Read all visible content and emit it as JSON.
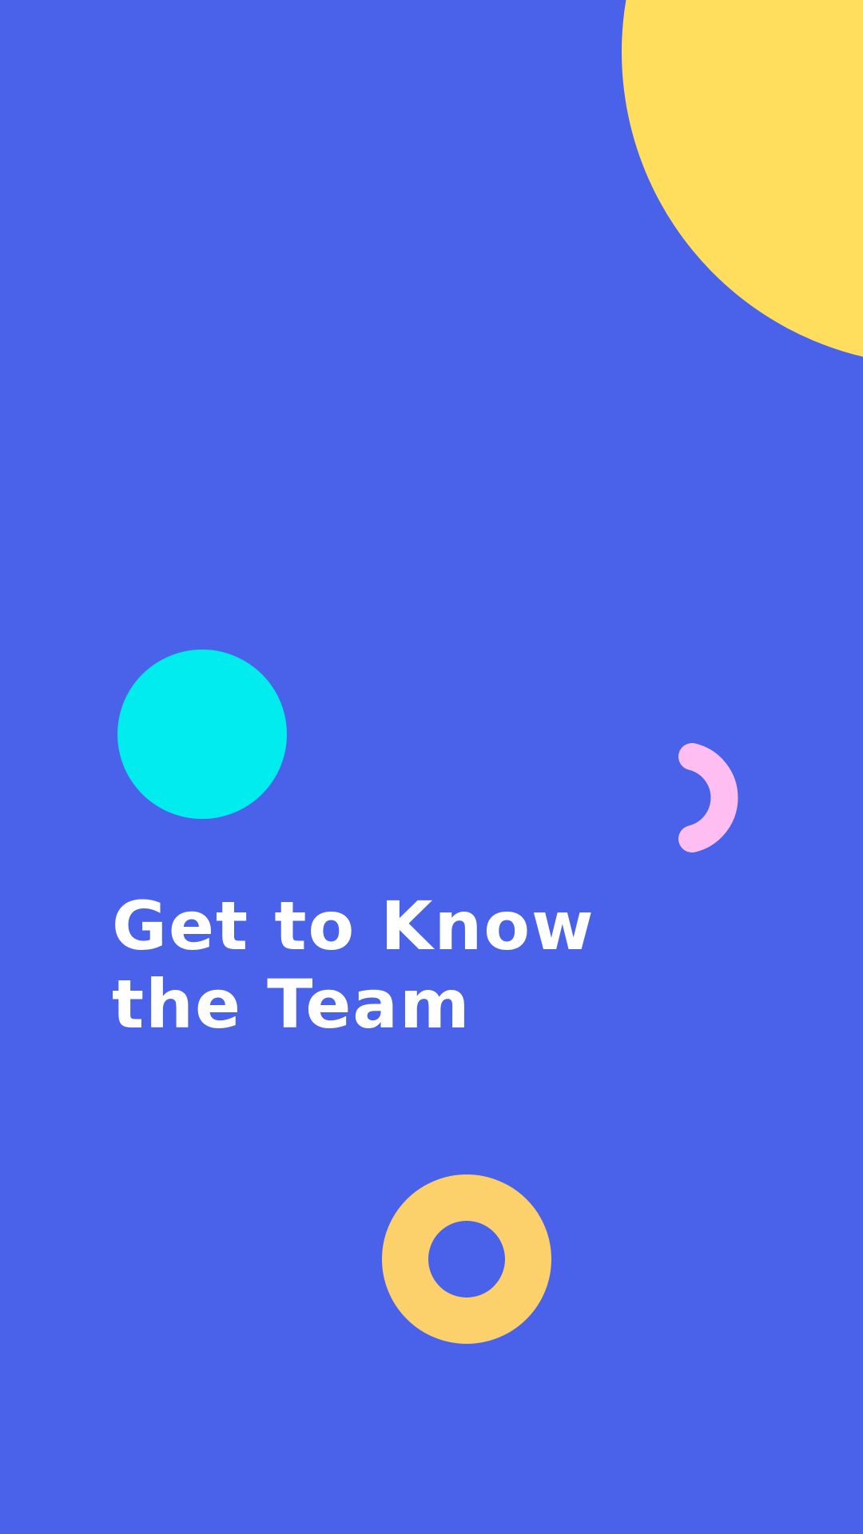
{
  "headline": {
    "line1": "Get to Know",
    "line2": "the Team"
  },
  "colors": {
    "background": "#4962E9",
    "yellow_circle": "#FFDE5E",
    "cyan_circle": "#00ECEE",
    "pink_arc": "#FFBEF1",
    "orange_ring": "#FCD06A",
    "text": "#FFFFFF"
  }
}
